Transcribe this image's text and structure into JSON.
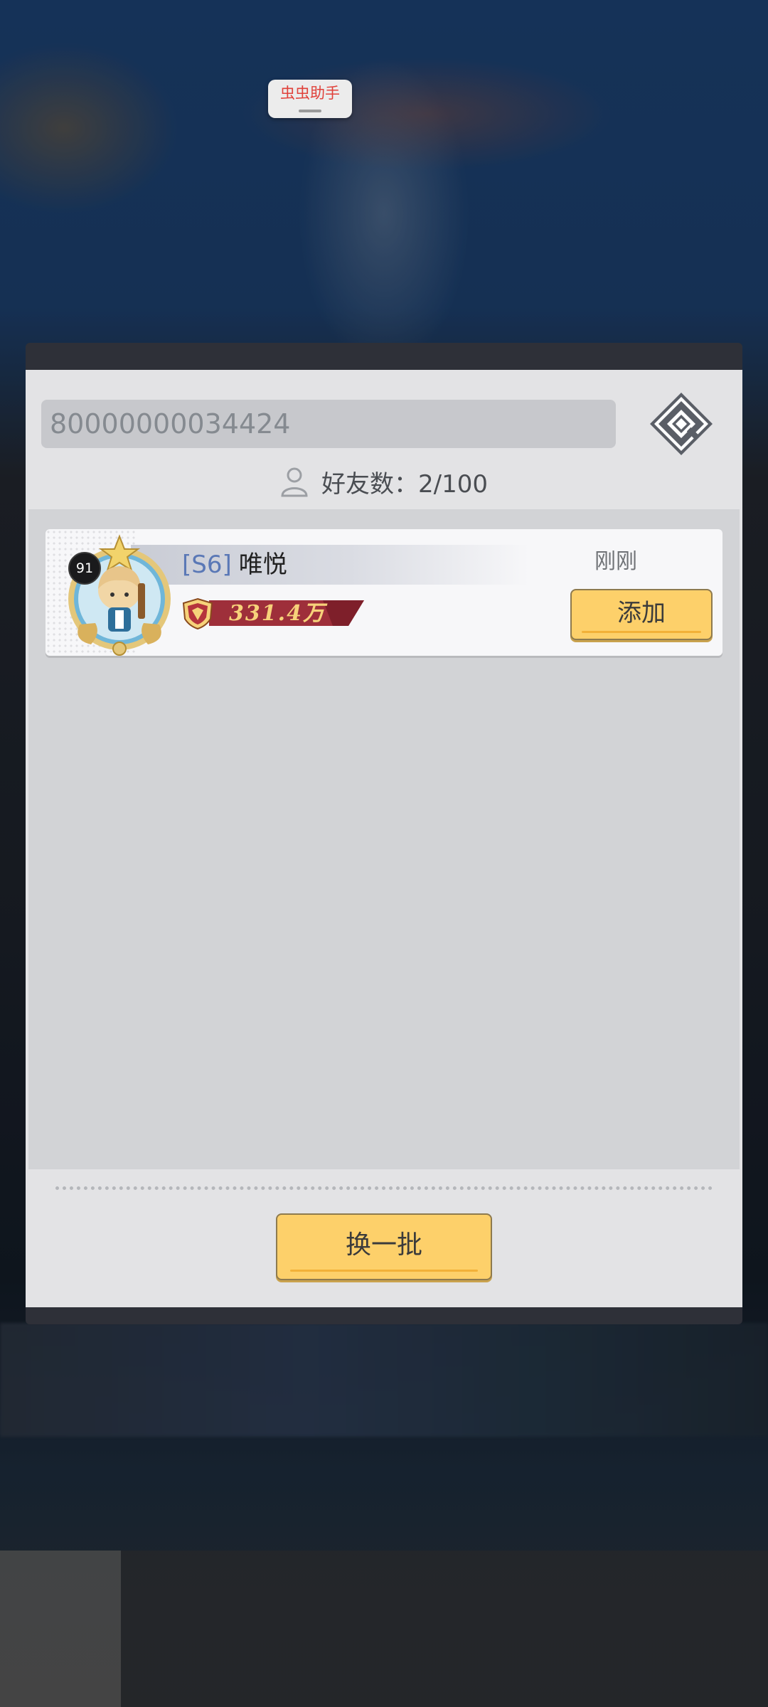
{
  "assistant": {
    "label": "虫虫助手"
  },
  "search": {
    "value": "80000000034424",
    "icon": "magnifier-icon"
  },
  "friends": {
    "count_text": "好友数：2/100",
    "icon": "person-icon"
  },
  "candidates": [
    {
      "level": "91",
      "server": "[S6]",
      "name": "唯悦",
      "power": "331.4万",
      "last_online": "刚刚",
      "add_label": "添加"
    }
  ],
  "footer": {
    "refresh_label": "换一批"
  },
  "colors": {
    "button": "#fdd06a",
    "server_tag": "#5a78b6",
    "power_tag": "#9e2f3a",
    "assistant_text": "#e0413a"
  }
}
